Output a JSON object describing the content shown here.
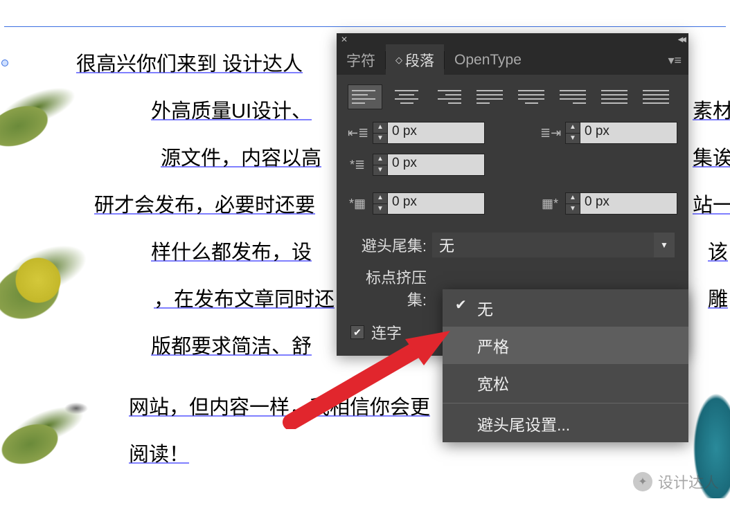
{
  "text": {
    "line1": "很高兴你们来到 设计达人",
    "line2": "外高质量UI设计、",
    "line2b": "素材",
    "line3": "源文件，内容以高",
    "line3b": "集诶",
    "line4": "研才会发布，必要时还要",
    "line4b": "站一",
    "line5": "样什么都发布，设",
    "line5b": "该",
    "line6": "，在发布文章同时还",
    "line6b": "雕",
    "line7": "版都要求简洁、舒",
    "line8": "网站，但内容一样，我相信你会更",
    "line9": "阅读！"
  },
  "panel": {
    "tabs": {
      "char": "字符",
      "para": "段落",
      "opentype": "OpenType"
    },
    "indent": {
      "left": "0 px",
      "right": "0 px",
      "firstline": "0 px",
      "before": "0 px",
      "after": "0 px"
    },
    "kinsoku_label": "避头尾集:",
    "kinsoku_value": "无",
    "mojikumi_label": "标点挤压集:",
    "hyphenate_label": "连字"
  },
  "dropdown": {
    "none": "无",
    "strict": "严格",
    "loose": "宽松",
    "settings": "避头尾设置..."
  },
  "watermark": {
    "text": "设计达人"
  }
}
